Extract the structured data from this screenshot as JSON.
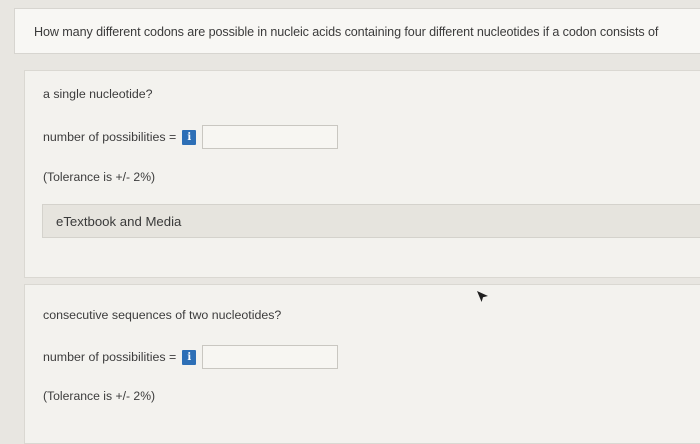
{
  "question": {
    "text": "How many different codons are possible in nucleic acids containing four different nucleotides if a codon consists of"
  },
  "parts": [
    {
      "prompt": "a single nucleotide?",
      "answer_label": "number of possibilities =",
      "info_icon": "info-icon",
      "input_value": "",
      "tolerance": "(Tolerance is +/- 2%)",
      "etextbook_label": "eTextbook and Media"
    },
    {
      "prompt": "consecutive sequences of two nucleotides?",
      "answer_label": "number of possibilities =",
      "info_icon": "info-icon",
      "input_value": "",
      "tolerance": "(Tolerance is +/- 2%)"
    }
  ],
  "colors": {
    "info_button": "#2d6fb6",
    "background": "#e8e6e1"
  }
}
